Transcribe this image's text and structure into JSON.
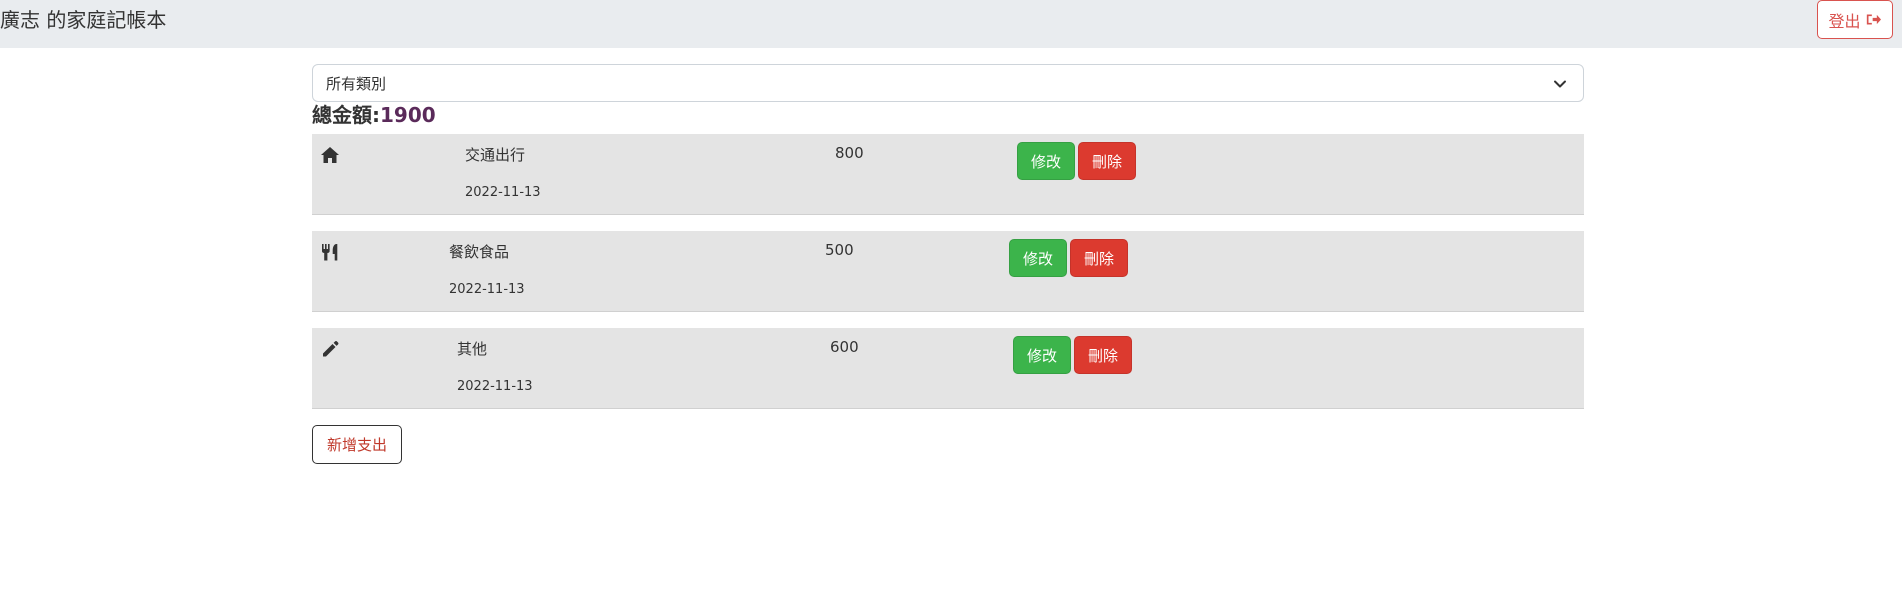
{
  "header": {
    "title": "廣志 的家庭記帳本",
    "logout_label": "登出",
    "logout_icon": "sign-out-icon"
  },
  "filter": {
    "selected": "所有類別"
  },
  "summary": {
    "label": "總金額:",
    "value": "1900"
  },
  "records": [
    {
      "icon": "home-icon",
      "category": "交通出行",
      "date": "2022-11-13",
      "amount": "800",
      "edit_label": "修改",
      "delete_label": "刪除"
    },
    {
      "icon": "utensils-icon",
      "category": "餐飲食品",
      "date": "2022-11-13",
      "amount": "500",
      "edit_label": "修改",
      "delete_label": "刪除"
    },
    {
      "icon": "pencil-icon",
      "category": "其他",
      "date": "2022-11-13",
      "amount": "600",
      "edit_label": "修改",
      "delete_label": "刪除"
    }
  ],
  "add_label": "新增支出",
  "colors": {
    "edit": "#3cb44b",
    "delete": "#dc3a2f",
    "logout": "#d9534f",
    "row_bg": "#e4e4e4",
    "navbar_bg": "#e9ecef"
  }
}
